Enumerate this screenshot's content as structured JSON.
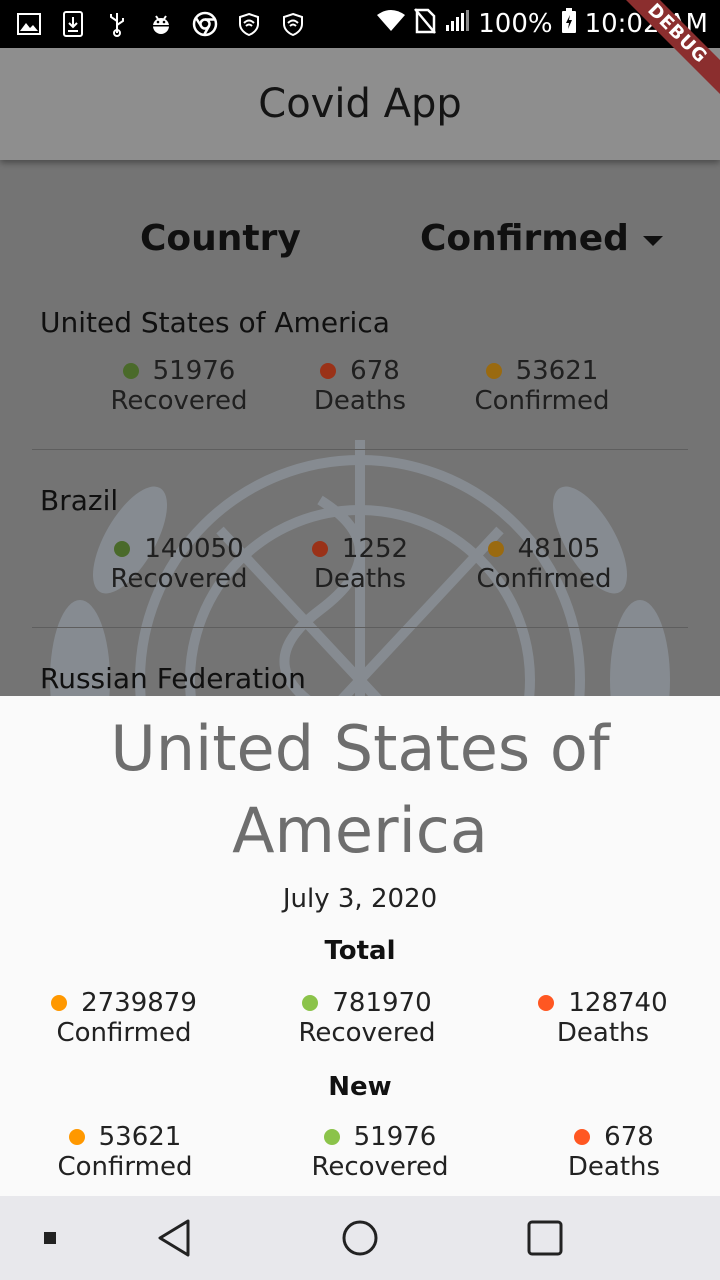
{
  "status_bar": {
    "battery": "100%",
    "time": "10:02 AM",
    "debug_label": "DEBUG",
    "left_icons": [
      "image-icon",
      "download-icon",
      "usb-icon",
      "android-debug-icon",
      "chrome-icon",
      "shield-wifi-icon",
      "shield-wifi-icon"
    ],
    "right_icons": [
      "wifi-icon",
      "no-sim-icon",
      "signal-icon",
      "battery-charging-icon"
    ]
  },
  "app_bar": {
    "title": "Covid App"
  },
  "table": {
    "header_country": "Country",
    "header_sort": "Confirmed",
    "rows": [
      {
        "country": "United States of America",
        "recovered": "51976",
        "recovered_label": "Recovered",
        "deaths": "678",
        "deaths_label": "Deaths",
        "confirmed": "53621",
        "confirmed_label": "Confirmed"
      },
      {
        "country": "Brazil",
        "recovered": "140050",
        "recovered_label": "Recovered",
        "deaths": "1252",
        "deaths_label": "Deaths",
        "confirmed": "48105",
        "confirmed_label": "Confirmed"
      },
      {
        "country": "Russian Federation"
      }
    ]
  },
  "detail": {
    "country_line1": "United States of",
    "country_line2": "America",
    "date": "July 3, 2020",
    "total_title": "Total",
    "total": {
      "confirmed": "2739879",
      "confirmed_label": "Confirmed",
      "recovered": "781970",
      "recovered_label": "Recovered",
      "deaths": "128740",
      "deaths_label": "Deaths"
    },
    "new_title": "New",
    "new": {
      "confirmed": "53621",
      "confirmed_label": "Confirmed",
      "recovered": "51976",
      "recovered_label": "Recovered",
      "deaths": "678",
      "deaths_label": "Deaths"
    }
  },
  "colors": {
    "recovered_dim": "#4a6a2a",
    "deaths_dim": "#9a3218",
    "confirmed_dim": "#9a6a10",
    "recovered": "#8bc34a",
    "deaths": "#ff5722",
    "confirmed": "#ff9800"
  },
  "nav_bar": {
    "icons": [
      "recents-small-icon",
      "back-icon",
      "home-icon",
      "overview-icon"
    ]
  }
}
